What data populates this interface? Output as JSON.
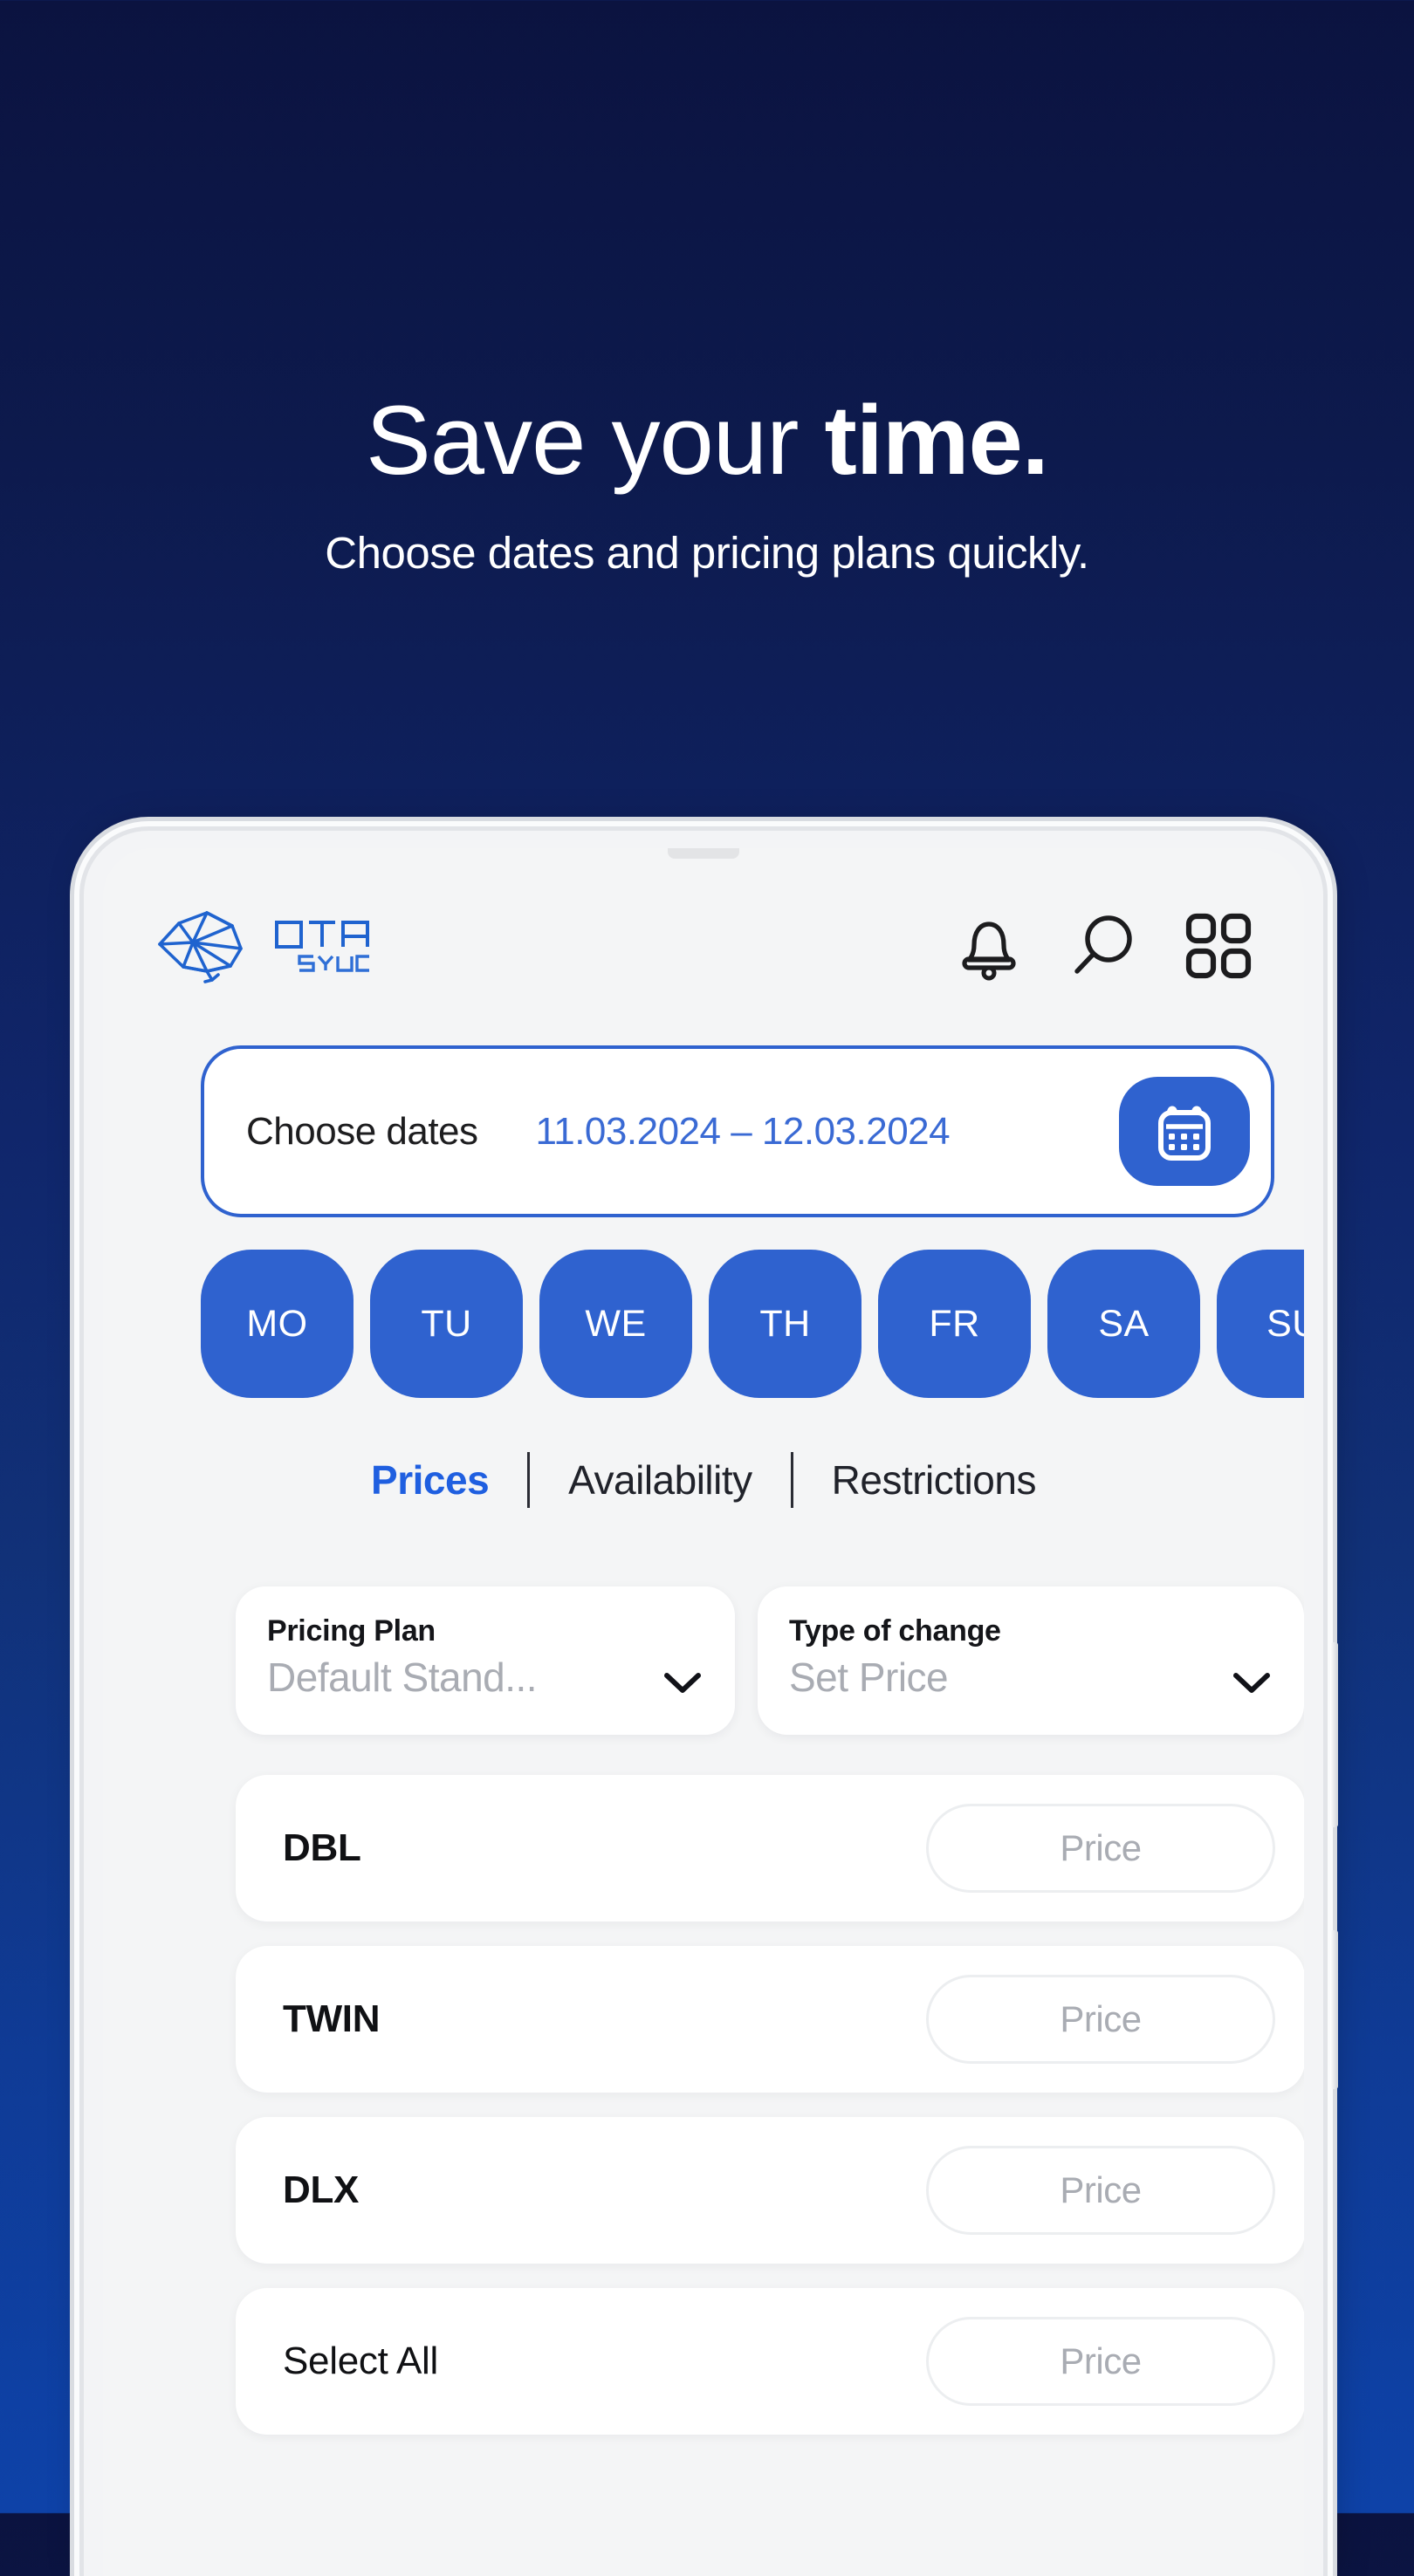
{
  "hero": {
    "title_normal": "Save your ",
    "title_accent": "time.",
    "subtitle": "Choose dates and pricing plans quickly."
  },
  "colors": {
    "bg_top": "#0b1340",
    "bg_bottom": "#0e42a8",
    "brand_blue": "#2f62cf",
    "tab_active": "#1f5fe0",
    "date_text": "#3a6ad4",
    "screen_bg": "#f4f5f6",
    "card_white": "#ffffff",
    "placeholder": "#a9acb3"
  },
  "app": {
    "brand": {
      "name_top": "OTA",
      "name_bottom": "SYNC"
    },
    "header_icons": [
      {
        "name": "notification-bell-icon"
      },
      {
        "name": "search-icon"
      },
      {
        "name": "apps-grid-icon"
      }
    ],
    "date_bar": {
      "label": "Choose dates",
      "range": "11.03.2024 – 12.03.2024",
      "calendar_icon": "calendar-icon"
    },
    "days": [
      {
        "label": "MO",
        "selected": true
      },
      {
        "label": "TU",
        "selected": true
      },
      {
        "label": "WE",
        "selected": true
      },
      {
        "label": "TH",
        "selected": true
      },
      {
        "label": "FR",
        "selected": true
      },
      {
        "label": "SA",
        "selected": true
      },
      {
        "label": "SU",
        "selected": true
      }
    ],
    "tabs": [
      {
        "label": "Prices",
        "active": true
      },
      {
        "label": "Availability",
        "active": false
      },
      {
        "label": "Restrictions",
        "active": false
      }
    ],
    "selects": [
      {
        "label": "Pricing Plan",
        "value": "Default Stand...",
        "icon": "chevron-down-icon"
      },
      {
        "label": "Type of change",
        "value": "Set Price",
        "icon": "chevron-down-icon"
      }
    ],
    "rows": [
      {
        "name": "DBL",
        "bold": true,
        "price_placeholder": "Price"
      },
      {
        "name": "TWIN",
        "bold": true,
        "price_placeholder": "Price"
      },
      {
        "name": "DLX",
        "bold": true,
        "price_placeholder": "Price"
      },
      {
        "name": "Select All",
        "bold": false,
        "price_placeholder": "Price"
      }
    ]
  }
}
